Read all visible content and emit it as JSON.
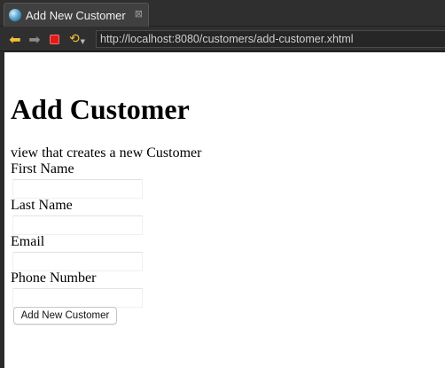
{
  "tab": {
    "title": "Add New Customer",
    "close_glyph": "⊠",
    "icon": "globe-icon"
  },
  "toolbar": {
    "back_glyph": "⬅",
    "forward_glyph": "➡",
    "refresh_glyph": "⟲",
    "refresh_caret": "▼",
    "url": "http://localhost:8080/customers/add-customer.xhtml"
  },
  "page": {
    "title": "Add Customer",
    "description": "view that creates a new Customer",
    "fields": [
      {
        "label": "First Name",
        "value": ""
      },
      {
        "label": "Last Name",
        "value": ""
      },
      {
        "label": "Email",
        "value": ""
      },
      {
        "label": "Phone Number",
        "value": ""
      }
    ],
    "submit_label": "Add New Customer"
  },
  "colors": {
    "chrome_bg": "#2f2f2f",
    "tab_bg": "#404040",
    "page_bg": "#ffffff",
    "back_arrow": "#f2c233",
    "stop": "#e01b1b"
  }
}
